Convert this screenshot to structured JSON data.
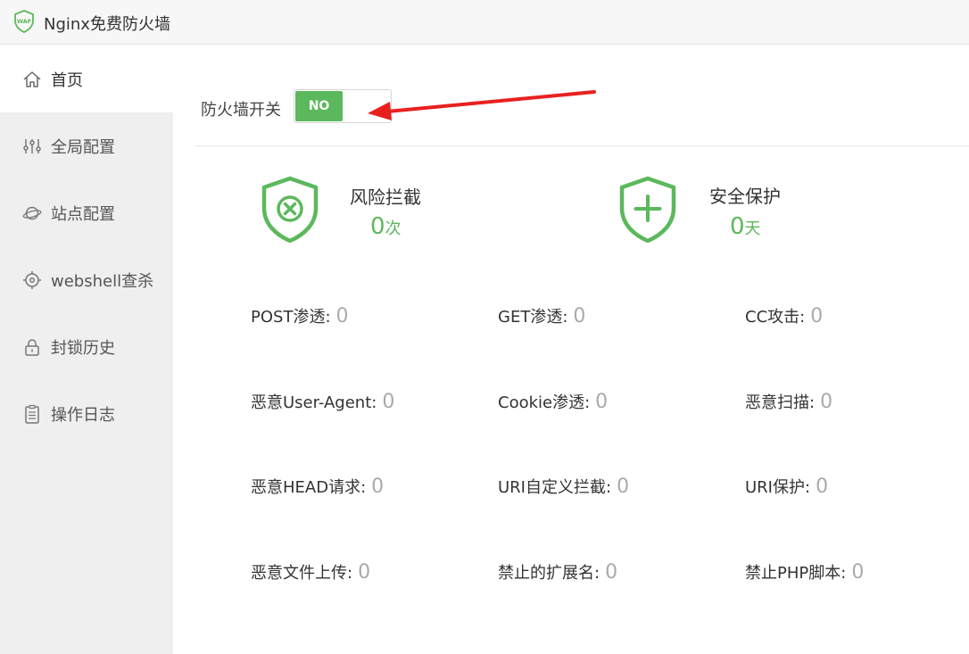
{
  "app": {
    "title": "Nginx免费防火墙",
    "logo_text": "WAF"
  },
  "sidebar": {
    "items": [
      {
        "label": "首页",
        "icon": "home-icon"
      },
      {
        "label": "全局配置",
        "icon": "sliders-icon"
      },
      {
        "label": "站点配置",
        "icon": "planet-icon"
      },
      {
        "label": "webshell查杀",
        "icon": "target-icon"
      },
      {
        "label": "封锁历史",
        "icon": "lock-icon"
      },
      {
        "label": "操作日志",
        "icon": "clipboard-icon"
      }
    ]
  },
  "main": {
    "switch_label": "防火墙开关",
    "switch_state": "NO",
    "risk": {
      "title": "风险拦截",
      "value": "0",
      "unit": "次"
    },
    "safe": {
      "title": "安全保护",
      "value": "0",
      "unit": "天"
    },
    "metrics": [
      {
        "label": "POST渗透:",
        "value": "0"
      },
      {
        "label": "GET渗透:",
        "value": "0"
      },
      {
        "label": "CC攻击:",
        "value": "0"
      },
      {
        "label": "恶意User-Agent:",
        "value": "0"
      },
      {
        "label": "Cookie渗透:",
        "value": "0"
      },
      {
        "label": "恶意扫描:",
        "value": "0"
      },
      {
        "label": "恶意HEAD请求:",
        "value": "0"
      },
      {
        "label": "URI自定义拦截:",
        "value": "0"
      },
      {
        "label": "URI保护:",
        "value": "0"
      },
      {
        "label": "恶意文件上传:",
        "value": "0"
      },
      {
        "label": "禁止的扩展名:",
        "value": "0"
      },
      {
        "label": "禁止PHP脚本:",
        "value": "0"
      }
    ]
  },
  "colors": {
    "accent": "#5cb85c",
    "arrow": "#e8211f",
    "sidebar_bg": "#efefef"
  }
}
